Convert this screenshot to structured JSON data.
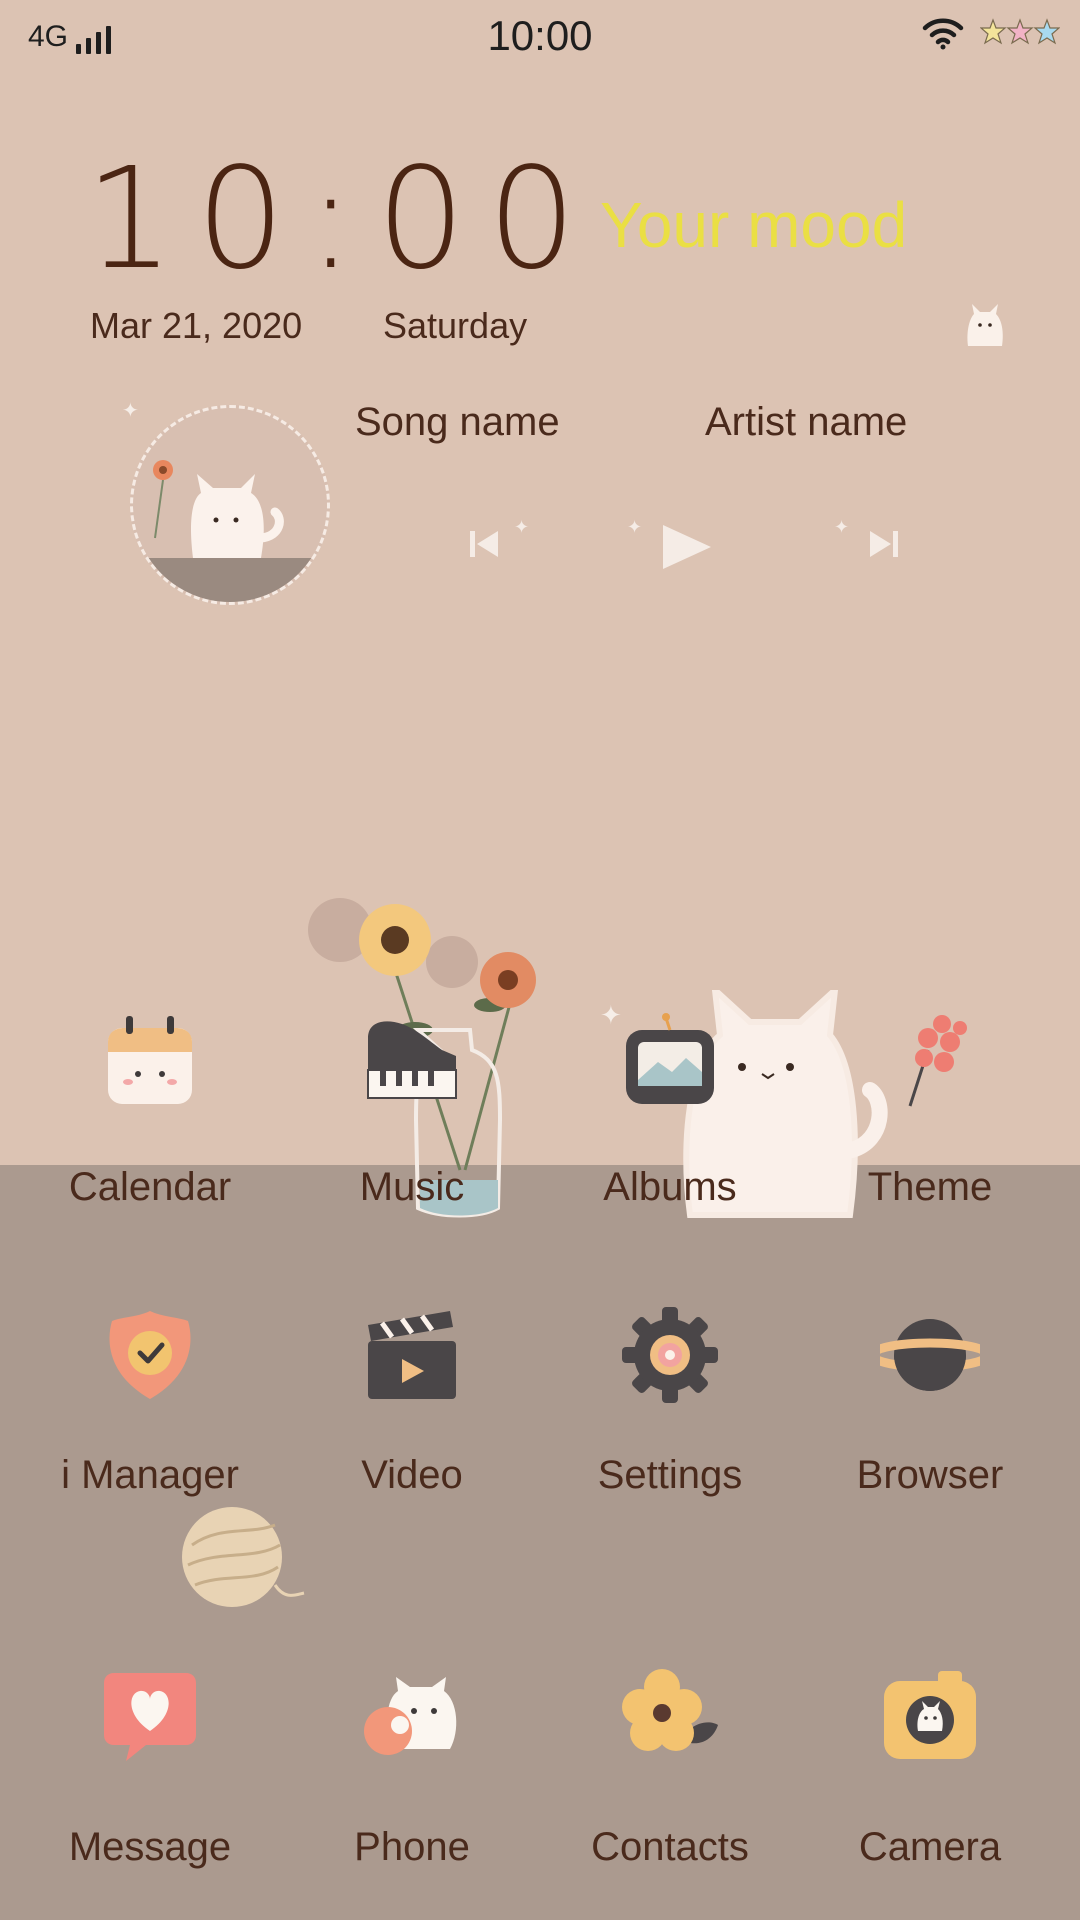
{
  "status_bar": {
    "network": "4G",
    "time": "10:00"
  },
  "widget": {
    "clock": "10:00",
    "mood": "Your mood",
    "date": "Mar 21, 2020",
    "weekday": "Saturday"
  },
  "music": {
    "song": "Song name",
    "artist": "Artist name"
  },
  "apps": [
    {
      "label": "Calendar",
      "icon": "calendar-icon"
    },
    {
      "label": "Music",
      "icon": "piano-icon"
    },
    {
      "label": "Albums",
      "icon": "tv-icon"
    },
    {
      "label": "Theme",
      "icon": "flower-icon"
    },
    {
      "label": "i Manager",
      "icon": "shield-icon"
    },
    {
      "label": "Video",
      "icon": "clapper-icon"
    },
    {
      "label": "Settings",
      "icon": "gear-icon"
    },
    {
      "label": "Browser",
      "icon": "planet-icon"
    },
    {
      "label": "Message",
      "icon": "heart-bubble-icon"
    },
    {
      "label": "Phone",
      "icon": "cat-phone-icon"
    },
    {
      "label": "Contacts",
      "icon": "flower-contacts-icon"
    },
    {
      "label": "Camera",
      "icon": "camera-icon"
    }
  ],
  "colors": {
    "top_background": "#dcc3b3",
    "bottom_background": "#ab9a8f",
    "text": "#4a2a1c",
    "mood": "#eadf44"
  }
}
